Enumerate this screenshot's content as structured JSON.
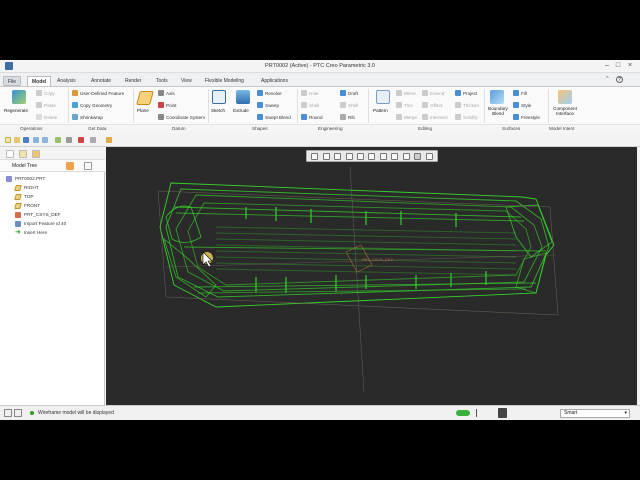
{
  "window": {
    "title": "PRT0002 (Active) - PTC Creo Parametric 3.0"
  },
  "tabs": [
    {
      "label": "File",
      "kind": "file"
    },
    {
      "label": "Model",
      "kind": "active"
    },
    {
      "label": "Analysis",
      "kind": ""
    },
    {
      "label": "Annotate",
      "kind": ""
    },
    {
      "label": "Render",
      "kind": ""
    },
    {
      "label": "Tools",
      "kind": ""
    },
    {
      "label": "View",
      "kind": ""
    },
    {
      "label": "Flexible Modeling",
      "kind": ""
    },
    {
      "label": "Applications",
      "kind": ""
    }
  ],
  "ribbon": {
    "operations": {
      "regenerate": "Regenerate",
      "copy": "Copy",
      "paste": "Paste",
      "delete": "Delete"
    },
    "get_data": {
      "udf": "User-Defined Feature",
      "copy_geometry": "Copy Geometry",
      "shrinkwrap": "Shrinkwrap"
    },
    "datum": {
      "plane": "Plane",
      "axis": "Axis",
      "point": "Point",
      "csys": "Coordinate System"
    },
    "shapes": {
      "sketch": "Sketch",
      "extrude": "Extrude",
      "revolve": "Revolve",
      "sweep": "Sweep",
      "swept_blend": "Swept Blend"
    },
    "engineering": {
      "hole": "Hole",
      "shell": "Shell",
      "round": "Round",
      "chamfer": "Chamfer",
      "draft": "Draft",
      "rib": "Rib"
    },
    "editing": {
      "pattern": "Pattern",
      "mirror": "Mirror",
      "trim": "Trim",
      "merge": "Merge",
      "extend": "Extend",
      "offset": "Offset",
      "intersect": "Intersect",
      "project": "Project",
      "thicken": "Thicken",
      "solidify": "Solidify"
    },
    "surfaces": {
      "boundary_blend": "Boundary Blend",
      "fill": "Fill",
      "style": "Style",
      "freestyle": "Freestyle"
    },
    "model_intent": {
      "component_interface": "Component Interface"
    },
    "groups": [
      "Operations",
      "Get Data",
      "Datum",
      "Shapes",
      "Engineering",
      "Editing",
      "Surfaces",
      "Model Intent"
    ]
  },
  "model_tree": {
    "header": "Model Tree",
    "items": [
      {
        "label": "PRT0002.PRT",
        "icon": "part-icon"
      },
      {
        "label": "RIGHT",
        "icon": "datum-plane-icon"
      },
      {
        "label": "TOP",
        "icon": "datum-plane-icon"
      },
      {
        "label": "FRONT",
        "icon": "datum-plane-icon"
      },
      {
        "label": "PRT_CSYS_DEF",
        "icon": "csys-icon"
      },
      {
        "label": "Import Feature id 40",
        "icon": "import-feature-icon"
      },
      {
        "label": "Insert Here",
        "icon": "insert-arrow-icon"
      }
    ]
  },
  "viewport": {
    "csys_label": "PRT_CSYS_DEF",
    "display_style": "wireframe",
    "model_color": "#36d22a"
  },
  "status": {
    "message": "Wireframe model will be displayed",
    "filter_value": "Smart"
  },
  "colors": {
    "accent": "#3a6ea5",
    "viewport_bg": "#2a2a2a",
    "wireframe": "#36d22a"
  }
}
